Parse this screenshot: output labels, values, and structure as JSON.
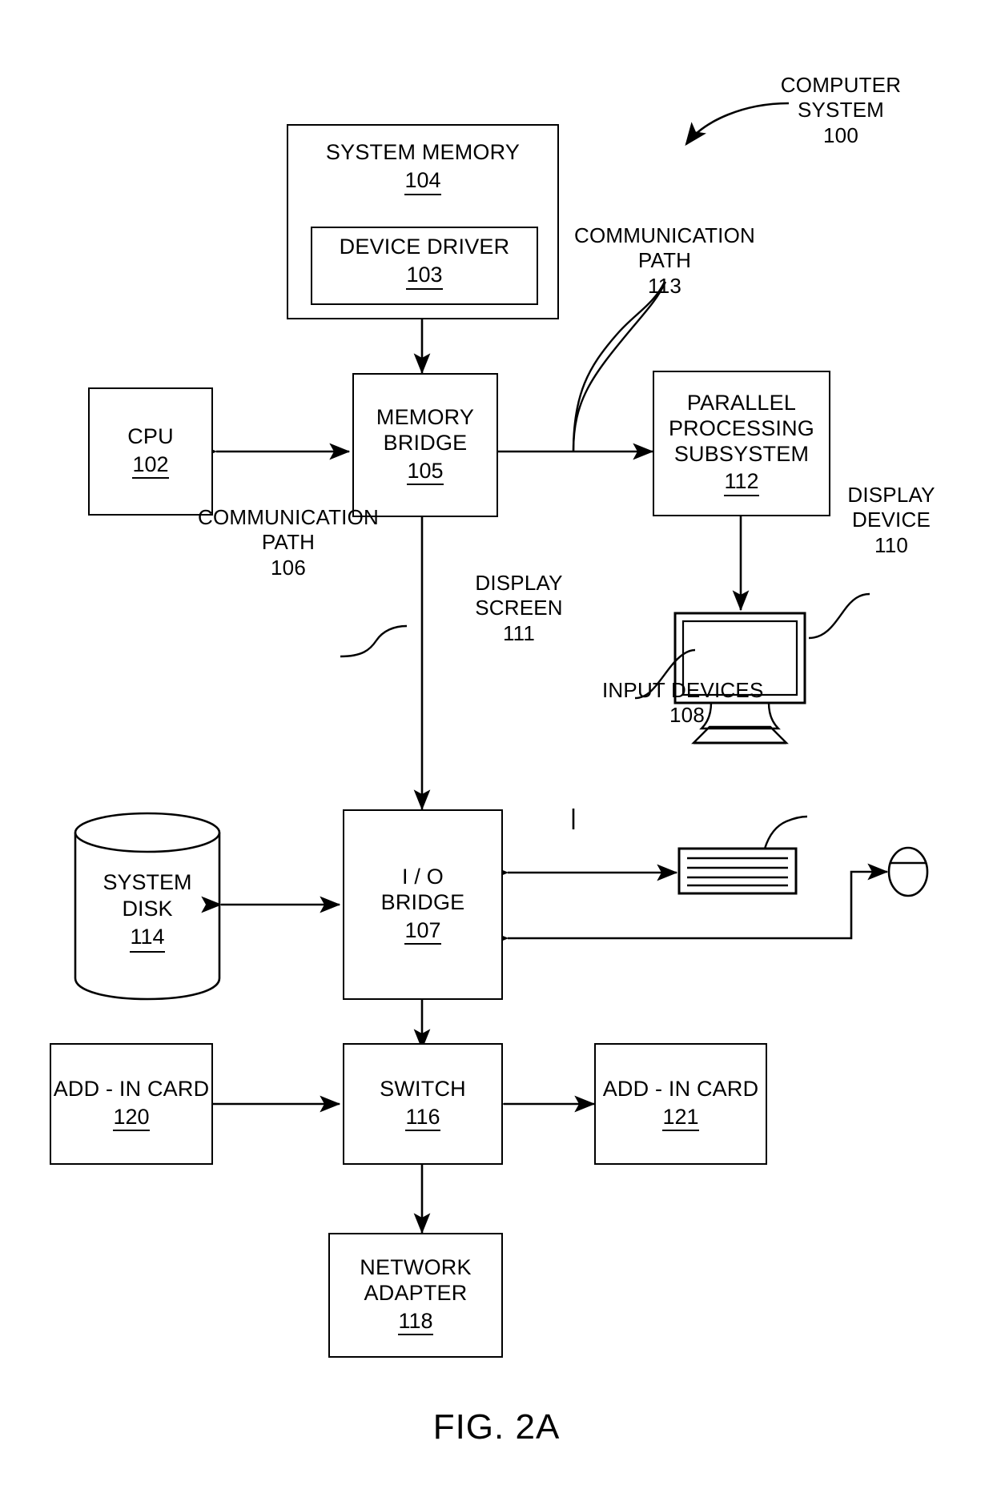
{
  "figure": {
    "caption": "FIG. 2A",
    "overall_label": {
      "text": "COMPUTER\nSYSTEM",
      "ref": "100"
    }
  },
  "blocks": [
    {
      "id": "system-memory",
      "title": "SYSTEM MEMORY",
      "ref": "104"
    },
    {
      "id": "device-driver",
      "title": "DEVICE DRIVER",
      "ref": "103"
    },
    {
      "id": "cpu",
      "title": "CPU",
      "ref": "102"
    },
    {
      "id": "memory-bridge",
      "title": "MEMORY\nBRIDGE",
      "ref": "105"
    },
    {
      "id": "parallel-processing-subsystem",
      "title": "PARALLEL\nPROCESSING\nSUBSYSTEM",
      "ref": "112"
    },
    {
      "id": "system-disk",
      "title": "SYSTEM\nDISK",
      "ref": "114"
    },
    {
      "id": "io-bridge",
      "title": "I / O\nBRIDGE",
      "ref": "107"
    },
    {
      "id": "add-in-card-120",
      "title": "ADD - IN CARD",
      "ref": "120"
    },
    {
      "id": "switch",
      "title": "SWITCH",
      "ref": "116"
    },
    {
      "id": "add-in-card-121",
      "title": "ADD - IN CARD",
      "ref": "121"
    },
    {
      "id": "network-adapter",
      "title": "NETWORK\nADAPTER",
      "ref": "118"
    }
  ],
  "callouts": {
    "communication_path_113": {
      "text": "COMMUNICATION\nPATH",
      "ref": "113"
    },
    "communication_path_106": {
      "text": "COMMUNICATION\nPATH",
      "ref": "106"
    },
    "display_device": {
      "text": "DISPLAY\nDEVICE",
      "ref": "110"
    },
    "display_screen": {
      "text": "DISPLAY\nSCREEN",
      "ref": "111"
    },
    "input_devices": {
      "text": "INPUT  DEVICES",
      "ref": "108"
    }
  },
  "colors": {
    "ink": "#000000",
    "paper": "#ffffff"
  }
}
